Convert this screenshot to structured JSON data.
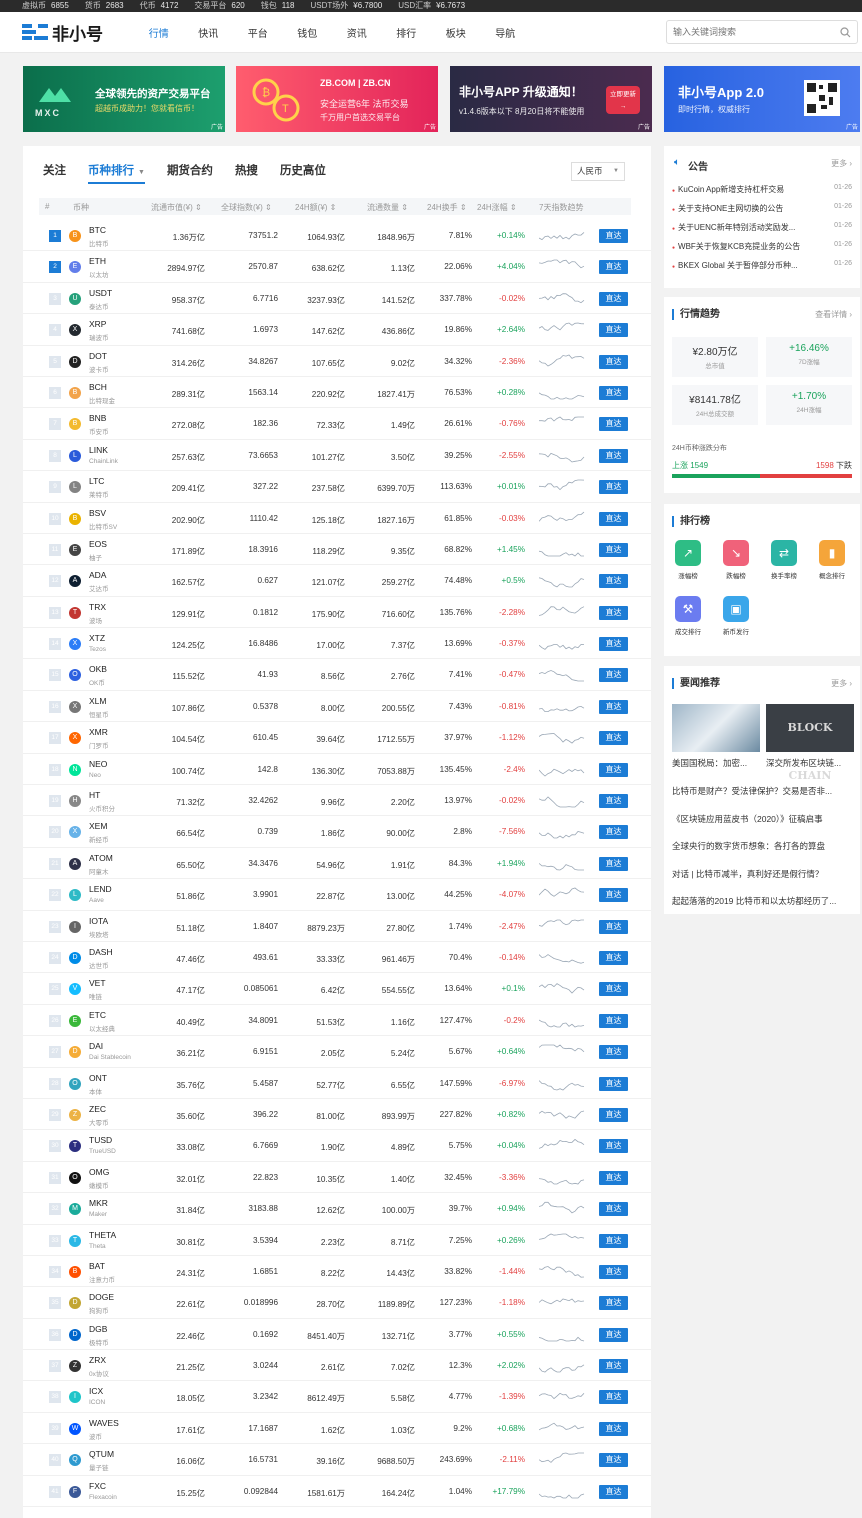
{
  "topbar": [
    {
      "label": "虚拟币",
      "value": "6855"
    },
    {
      "label": "货币",
      "value": "2683"
    },
    {
      "label": "代币",
      "value": "4172"
    },
    {
      "label": "交易平台",
      "value": "620"
    },
    {
      "label": "钱包",
      "value": "118"
    },
    {
      "label": "USDT场外",
      "value": "¥6.7800"
    },
    {
      "label": "USD汇率",
      "value": "¥6.7673"
    }
  ],
  "nav": {
    "logo": "非小号",
    "links": [
      "行情",
      "快讯",
      "平台",
      "钱包",
      "资讯",
      "排行",
      "板块",
      "导航"
    ],
    "active": 0,
    "search_placeholder": "输入关键词搜索"
  },
  "banners": {
    "mxc": {
      "brand": "MXC",
      "title": "全球领先的资产交易平台",
      "sub": "超越币成助力！您就看信币！"
    },
    "zb": {
      "brand": "ZB.COM | ZB.CN",
      "title": "安全运营6年 法币交易",
      "sub": "千万用户首选交易平台"
    },
    "app": {
      "title": "非小号APP 升级通知！",
      "sub": "v1.4.6版本以下 8月20日将不能使用",
      "btn": "立即更新"
    },
    "app2": {
      "title": "非小号App 2.0",
      "sub": "即时行情，权威排行",
      "ad": "广告"
    },
    "ad_label": "广告"
  },
  "tabs": [
    "关注",
    "币种排行",
    "期货合约",
    "热搜",
    "历史高位"
  ],
  "active_tab": 1,
  "currency": "人民币",
  "table_headers": [
    "#",
    "币种",
    "流通市值(¥)",
    "全球指数(¥)",
    "24H额(¥)",
    "流通数量",
    "24H换手",
    "24H涨幅",
    "7天指数趋势"
  ],
  "goto_label": "直达",
  "coins": [
    {
      "rank": "1",
      "sym": "BTC",
      "cn": "比特币",
      "mcap": "1.36万亿",
      "idx": "73751.2",
      "vol": "1064.93亿",
      "sup": "1848.96万",
      "turn": "7.81%",
      "chg": "+0.14%",
      "color": "#f7931a"
    },
    {
      "rank": "2",
      "sym": "ETH",
      "cn": "以太坊",
      "mcap": "2894.97亿",
      "idx": "2570.87",
      "vol": "638.62亿",
      "sup": "1.13亿",
      "turn": "22.06%",
      "chg": "+4.04%",
      "color": "#627eea"
    },
    {
      "rank": "3",
      "sym": "USDT",
      "cn": "泰达币",
      "mcap": "958.37亿",
      "idx": "6.7716",
      "vol": "3237.93亿",
      "sup": "141.52亿",
      "turn": "337.78%",
      "chg": "-0.02%",
      "color": "#26a17b"
    },
    {
      "rank": "4",
      "sym": "XRP",
      "cn": "瑞波币",
      "mcap": "741.68亿",
      "idx": "1.6973",
      "vol": "147.62亿",
      "sup": "436.86亿",
      "turn": "19.86%",
      "chg": "+2.64%",
      "color": "#23292f"
    },
    {
      "rank": "5",
      "sym": "DOT",
      "cn": "波卡币",
      "mcap": "314.26亿",
      "idx": "34.8267",
      "vol": "107.65亿",
      "sup": "9.02亿",
      "turn": "34.32%",
      "chg": "-2.36%",
      "color": "#222222"
    },
    {
      "rank": "6",
      "sym": "BCH",
      "cn": "比特现金",
      "mcap": "289.31亿",
      "idx": "1563.14",
      "vol": "220.92亿",
      "sup": "1827.41万",
      "turn": "76.53%",
      "chg": "+0.28%",
      "color": "#f2a34a"
    },
    {
      "rank": "7",
      "sym": "BNB",
      "cn": "币安币",
      "mcap": "272.08亿",
      "idx": "182.36",
      "vol": "72.33亿",
      "sup": "1.49亿",
      "turn": "26.61%",
      "chg": "-0.76%",
      "color": "#f3ba2f"
    },
    {
      "rank": "8",
      "sym": "LINK",
      "cn": "ChainLink",
      "mcap": "257.63亿",
      "idx": "73.6653",
      "vol": "101.27亿",
      "sup": "3.50亿",
      "turn": "39.25%",
      "chg": "-2.55%",
      "color": "#2a5ada"
    },
    {
      "rank": "9",
      "sym": "LTC",
      "cn": "莱特币",
      "mcap": "209.41亿",
      "idx": "327.22",
      "vol": "237.58亿",
      "sup": "6399.70万",
      "turn": "113.63%",
      "chg": "+0.01%",
      "color": "#838383"
    },
    {
      "rank": "10",
      "sym": "BSV",
      "cn": "比特币SV",
      "mcap": "202.90亿",
      "idx": "1110.42",
      "vol": "125.18亿",
      "sup": "1827.16万",
      "turn": "61.85%",
      "chg": "-0.03%",
      "color": "#eab300"
    },
    {
      "rank": "11",
      "sym": "EOS",
      "cn": "柚子",
      "mcap": "171.89亿",
      "idx": "18.3916",
      "vol": "118.29亿",
      "sup": "9.35亿",
      "turn": "68.82%",
      "chg": "+1.45%",
      "color": "#444444"
    },
    {
      "rank": "12",
      "sym": "ADA",
      "cn": "艾达币",
      "mcap": "162.57亿",
      "idx": "0.627",
      "vol": "121.07亿",
      "sup": "259.27亿",
      "turn": "74.48%",
      "chg": "+0.5%",
      "color": "#0d1e30"
    },
    {
      "rank": "13",
      "sym": "TRX",
      "cn": "波场",
      "mcap": "129.91亿",
      "idx": "0.1812",
      "vol": "175.90亿",
      "sup": "716.60亿",
      "turn": "135.76%",
      "chg": "-2.28%",
      "color": "#c23631"
    },
    {
      "rank": "14",
      "sym": "XTZ",
      "cn": "Tezos",
      "mcap": "124.25亿",
      "idx": "16.8486",
      "vol": "17.00亿",
      "sup": "7.37亿",
      "turn": "13.69%",
      "chg": "-0.37%",
      "color": "#2c7df7"
    },
    {
      "rank": "15",
      "sym": "OKB",
      "cn": "OK币",
      "mcap": "115.52亿",
      "idx": "41.93",
      "vol": "8.56亿",
      "sup": "2.76亿",
      "turn": "7.41%",
      "chg": "-0.47%",
      "color": "#2d60e0"
    },
    {
      "rank": "16",
      "sym": "XLM",
      "cn": "恒星币",
      "mcap": "107.86亿",
      "idx": "0.5378",
      "vol": "8.00亿",
      "sup": "200.55亿",
      "turn": "7.43%",
      "chg": "-0.81%",
      "color": "#777777"
    },
    {
      "rank": "17",
      "sym": "XMR",
      "cn": "门罗币",
      "mcap": "104.54亿",
      "idx": "610.45",
      "vol": "39.64亿",
      "sup": "1712.55万",
      "turn": "37.97%",
      "chg": "-1.12%",
      "color": "#ff6600"
    },
    {
      "rank": "18",
      "sym": "NEO",
      "cn": "Neo",
      "mcap": "100.74亿",
      "idx": "142.8",
      "vol": "136.30亿",
      "sup": "7053.88万",
      "turn": "135.45%",
      "chg": "-2.4%",
      "color": "#00e599"
    },
    {
      "rank": "19",
      "sym": "HT",
      "cn": "火币积分",
      "mcap": "71.32亿",
      "idx": "32.4262",
      "vol": "9.96亿",
      "sup": "2.20亿",
      "turn": "13.97%",
      "chg": "-0.02%",
      "color": "#888888"
    },
    {
      "rank": "20",
      "sym": "XEM",
      "cn": "新经币",
      "mcap": "66.54亿",
      "idx": "0.739",
      "vol": "1.86亿",
      "sup": "90.00亿",
      "turn": "2.8%",
      "chg": "-7.56%",
      "color": "#67b2e8"
    },
    {
      "rank": "21",
      "sym": "ATOM",
      "cn": "阿童木",
      "mcap": "65.50亿",
      "idx": "34.3476",
      "vol": "54.96亿",
      "sup": "1.91亿",
      "turn": "84.3%",
      "chg": "+1.94%",
      "color": "#2e3148"
    },
    {
      "rank": "22",
      "sym": "LEND",
      "cn": "Aave",
      "mcap": "51.86亿",
      "idx": "3.9901",
      "vol": "22.87亿",
      "sup": "13.00亿",
      "turn": "44.25%",
      "chg": "-4.07%",
      "color": "#2ebac6"
    },
    {
      "rank": "23",
      "sym": "IOTA",
      "cn": "埃欧塔",
      "mcap": "51.18亿",
      "idx": "1.8407",
      "vol": "8879.23万",
      "sup": "27.80亿",
      "turn": "1.74%",
      "chg": "-2.47%",
      "color": "#666666"
    },
    {
      "rank": "24",
      "sym": "DASH",
      "cn": "达世币",
      "mcap": "47.46亿",
      "idx": "493.61",
      "vol": "33.33亿",
      "sup": "961.46万",
      "turn": "70.4%",
      "chg": "-0.14%",
      "color": "#008ce7"
    },
    {
      "rank": "25",
      "sym": "VET",
      "cn": "唯链",
      "mcap": "47.17亿",
      "idx": "0.085061",
      "vol": "6.42亿",
      "sup": "554.55亿",
      "turn": "13.64%",
      "chg": "+0.1%",
      "color": "#15bdff"
    },
    {
      "rank": "26",
      "sym": "ETC",
      "cn": "以太经典",
      "mcap": "40.49亿",
      "idx": "34.8091",
      "vol": "51.53亿",
      "sup": "1.16亿",
      "turn": "127.47%",
      "chg": "-0.2%",
      "color": "#3ab83a"
    },
    {
      "rank": "27",
      "sym": "DAI",
      "cn": "Dai Stablecoin",
      "mcap": "36.21亿",
      "idx": "6.9151",
      "vol": "2.05亿",
      "sup": "5.24亿",
      "turn": "5.67%",
      "chg": "+0.64%",
      "color": "#f5ac37"
    },
    {
      "rank": "28",
      "sym": "ONT",
      "cn": "本体",
      "mcap": "35.76亿",
      "idx": "5.4587",
      "vol": "52.77亿",
      "sup": "6.55亿",
      "turn": "147.59%",
      "chg": "-6.97%",
      "color": "#32a4be"
    },
    {
      "rank": "29",
      "sym": "ZEC",
      "cn": "大零币",
      "mcap": "35.60亿",
      "idx": "396.22",
      "vol": "81.00亿",
      "sup": "893.99万",
      "turn": "227.82%",
      "chg": "+0.82%",
      "color": "#ecb244"
    },
    {
      "rank": "30",
      "sym": "TUSD",
      "cn": "TrueUSD",
      "mcap": "33.08亿",
      "idx": "6.7669",
      "vol": "1.90亿",
      "sup": "4.89亿",
      "turn": "5.75%",
      "chg": "+0.04%",
      "color": "#2b2e7f"
    },
    {
      "rank": "31",
      "sym": "OMG",
      "cn": "嫩模币",
      "mcap": "32.01亿",
      "idx": "22.823",
      "vol": "10.35亿",
      "sup": "1.40亿",
      "turn": "32.45%",
      "chg": "-3.36%",
      "color": "#101010"
    },
    {
      "rank": "32",
      "sym": "MKR",
      "cn": "Maker",
      "mcap": "31.84亿",
      "idx": "3183.88",
      "vol": "12.62亿",
      "sup": "100.00万",
      "turn": "39.7%",
      "chg": "+0.94%",
      "color": "#1aab9b"
    },
    {
      "rank": "33",
      "sym": "THETA",
      "cn": "Theta",
      "mcap": "30.81亿",
      "idx": "3.5394",
      "vol": "2.23亿",
      "sup": "8.71亿",
      "turn": "7.25%",
      "chg": "+0.26%",
      "color": "#2ab8e6"
    },
    {
      "rank": "34",
      "sym": "BAT",
      "cn": "注意力币",
      "mcap": "24.31亿",
      "idx": "1.6851",
      "vol": "8.22亿",
      "sup": "14.43亿",
      "turn": "33.82%",
      "chg": "-1.44%",
      "color": "#ff5000"
    },
    {
      "rank": "35",
      "sym": "DOGE",
      "cn": "狗狗币",
      "mcap": "22.61亿",
      "idx": "0.018996",
      "vol": "28.70亿",
      "sup": "1189.89亿",
      "turn": "127.23%",
      "chg": "-1.18%",
      "color": "#c2a633"
    },
    {
      "rank": "36",
      "sym": "DGB",
      "cn": "极特币",
      "mcap": "22.46亿",
      "idx": "0.1692",
      "vol": "8451.40万",
      "sup": "132.71亿",
      "turn": "3.77%",
      "chg": "+0.55%",
      "color": "#0066cc"
    },
    {
      "rank": "37",
      "sym": "ZRX",
      "cn": "0x协议",
      "mcap": "21.25亿",
      "idx": "3.0244",
      "vol": "2.61亿",
      "sup": "7.02亿",
      "turn": "12.3%",
      "chg": "+2.02%",
      "color": "#333333"
    },
    {
      "rank": "38",
      "sym": "ICX",
      "cn": "ICON",
      "mcap": "18.05亿",
      "idx": "3.2342",
      "vol": "8612.49万",
      "sup": "5.58亿",
      "turn": "4.77%",
      "chg": "-1.39%",
      "color": "#1fc5c9"
    },
    {
      "rank": "39",
      "sym": "WAVES",
      "cn": "波币",
      "mcap": "17.61亿",
      "idx": "17.1687",
      "vol": "1.62亿",
      "sup": "1.03亿",
      "turn": "9.2%",
      "chg": "+0.68%",
      "color": "#0155ff"
    },
    {
      "rank": "40",
      "sym": "QTUM",
      "cn": "量子链",
      "mcap": "16.06亿",
      "idx": "16.5731",
      "vol": "39.16亿",
      "sup": "9688.50万",
      "turn": "243.69%",
      "chg": "-2.11%",
      "color": "#2e9ad0"
    },
    {
      "rank": "41",
      "sym": "FXC",
      "cn": "Flexacoin",
      "mcap": "15.25亿",
      "idx": "0.092844",
      "vol": "1581.61万",
      "sup": "164.24亿",
      "turn": "1.04%",
      "chg": "+17.79%",
      "color": "#3b5998"
    }
  ],
  "announcements": {
    "title": "公告",
    "more": "更多",
    "items": [
      {
        "text": "KuCoin App新增支持杠杆交易",
        "date": "01-26"
      },
      {
        "text": "关于支持ONE主网切换的公告",
        "date": "01-26"
      },
      {
        "text": "关于UENC新年特别活动奖励发...",
        "date": "01-26"
      },
      {
        "text": "WBF关于恢复KCB充提业务的公告",
        "date": "01-26"
      },
      {
        "text": "BKEX Global 关于暂停部分币种...",
        "date": "01-26"
      }
    ]
  },
  "trend": {
    "title": "行情趋势",
    "more": "查看详情",
    "boxes": [
      {
        "value": "¥2.80万亿",
        "label": "总市值"
      },
      {
        "value": "+16.46%",
        "label": "7D涨幅"
      },
      {
        "value": "¥8141.78亿",
        "label": "24H总成交额"
      },
      {
        "value": "+1.70%",
        "label": "24H涨幅"
      }
    ],
    "dist_label": "24H币种涨跌分布",
    "up_label": "上涨",
    "up_count": "1549",
    "down_label": "下跌",
    "down_count": "1598",
    "up_ratio": 0.49
  },
  "rankings": {
    "title": "排行榜",
    "items": [
      {
        "label": "涨幅榜",
        "color": "#2ebd85"
      },
      {
        "label": "跌幅榜",
        "color": "#f0627a"
      },
      {
        "label": "换手率榜",
        "color": "#2bb5a5"
      },
      {
        "label": "概念排行",
        "color": "#f5a53a"
      },
      {
        "label": "成交排行",
        "color": "#6b7cf0"
      },
      {
        "label": "新币发行",
        "color": "#3aa6ea"
      }
    ]
  },
  "news": {
    "title": "要闻推荐",
    "more": "更多",
    "img_captions": [
      "美国国税局：加密...",
      "深交所发布区块链..."
    ],
    "img2_text": "BLOCK CHAIN",
    "items": [
      "比特币是财产？受法律保护？交易是否非...",
      "《区块链应用蓝皮书（2020）》征稿启事",
      "全球央行的数字货币想象：各打各的算盘",
      "对话 | 比特币减半，真利好还是假行情？",
      "起起落落的2019 比特币和以太坊都经历了..."
    ]
  }
}
